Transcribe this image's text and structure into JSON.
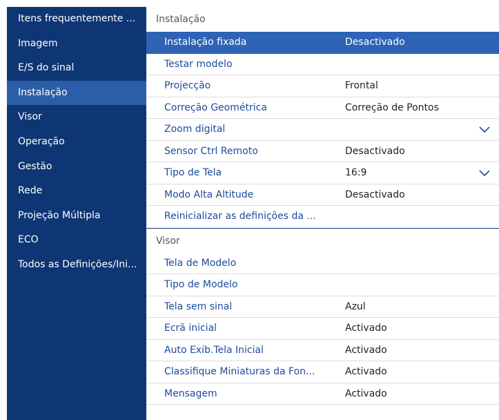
{
  "sidebar": {
    "items": [
      {
        "label": "Itens frequentemente ..."
      },
      {
        "label": "Imagem"
      },
      {
        "label": "E/S do sinal"
      },
      {
        "label": "Instalação"
      },
      {
        "label": "Visor"
      },
      {
        "label": "Operação"
      },
      {
        "label": "Gestão"
      },
      {
        "label": "Rede"
      },
      {
        "label": "Projeção Múltipla"
      },
      {
        "label": "ECO"
      },
      {
        "label": "Todos as Definições/Ini..."
      }
    ],
    "selected_index": 3
  },
  "installation": {
    "header": "Instalação",
    "rows": [
      {
        "label": "Instalação fixada",
        "value": "Desactivado"
      },
      {
        "label": "Testar modelo",
        "value": ""
      },
      {
        "label": "Projecção",
        "value": "Frontal"
      },
      {
        "label": "Correção Geométrica",
        "value": "Correção de Pontos"
      },
      {
        "label": "Zoom digital",
        "value": ""
      },
      {
        "label": "Sensor Ctrl Remoto",
        "value": "Desactivado"
      },
      {
        "label": "Tipo de Tela",
        "value": "16:9"
      },
      {
        "label": "Modo Alta Altitude",
        "value": "Desactivado"
      },
      {
        "label": "Reinicializar as definições da ...",
        "value": ""
      }
    ]
  },
  "visor": {
    "header": "Visor",
    "rows": [
      {
        "label": "Tela de Modelo",
        "value": ""
      },
      {
        "label": "Tipo de Modelo",
        "value": ""
      },
      {
        "label": "Tela sem sinal",
        "value": "Azul"
      },
      {
        "label": "Ecrã inicial",
        "value": "Activado"
      },
      {
        "label": "Auto Exib.Tela Inicial",
        "value": "Activado"
      },
      {
        "label": "Classifique Miniaturas da Fon...",
        "value": "Activado"
      },
      {
        "label": "Mensagem",
        "value": "Activado"
      }
    ]
  },
  "colors": {
    "sidebar_bg": "#0e3674",
    "sidebar_selected": "#2b5ea8",
    "row_selected": "#2e63b6",
    "label_text": "#1c4b9c"
  }
}
